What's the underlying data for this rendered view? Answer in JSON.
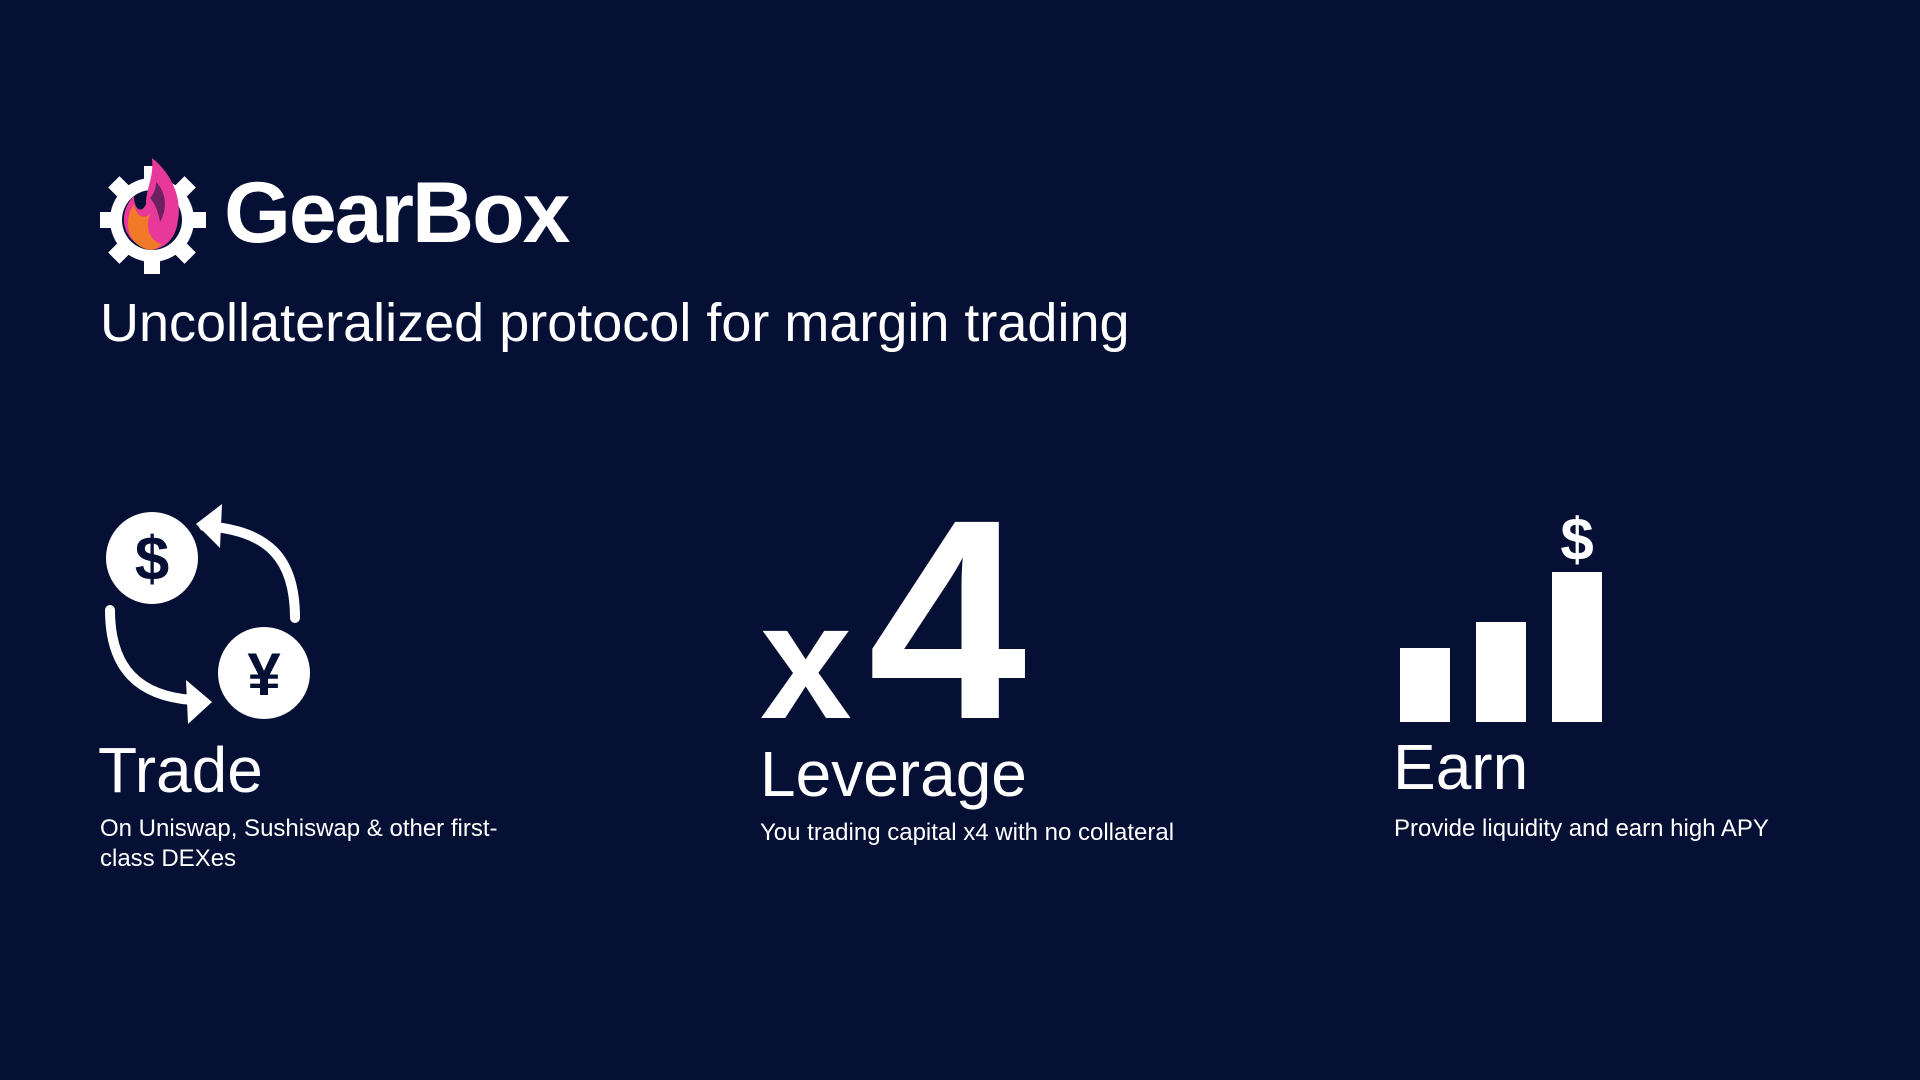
{
  "brand": {
    "name": "GearBox",
    "logo_icon": "gear-flame-icon",
    "tagline": "Uncollateralized protocol for margin trading"
  },
  "features": {
    "trade": {
      "icon": "currency-exchange-icon",
      "symbol_dollar": "$",
      "symbol_yen": "¥",
      "title": "Trade",
      "description": "On Uniswap, Sushiswap & other first-class DEXes"
    },
    "leverage": {
      "icon": "x4-multiplier",
      "prefix": "x",
      "multiplier": "4",
      "title": "Leverage",
      "description": "You trading capital x4 with no collateral"
    },
    "earn": {
      "icon": "growth-bars-icon",
      "symbol": "$",
      "title": "Earn",
      "description": "Provide liquidity and earn high APY"
    }
  },
  "colors": {
    "background": "#060f34",
    "text": "#ffffff",
    "flame_orange": "#f07a28",
    "flame_pink": "#e8399a"
  }
}
